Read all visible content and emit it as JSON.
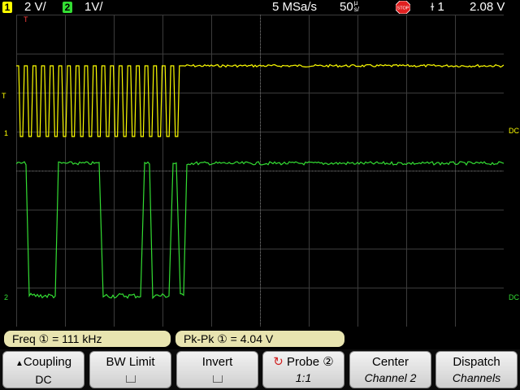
{
  "status": {
    "ch1_num": "1",
    "ch1_scale": "2 V/",
    "ch2_num": "2",
    "ch2_scale": "1V/",
    "sample_rate": "5 MSa/s",
    "timebase": "50",
    "timebase_unit_top": "µ",
    "timebase_unit_bottom": "s/",
    "run_state": "STOP",
    "trigger_source": "1",
    "trigger_level": "2.08  V"
  },
  "markers": {
    "trigger_top": "T",
    "trigger_left": "T",
    "ch1_ground": "1",
    "ch2_ground": "2",
    "dc_right_1": "DC",
    "dc_right_2": "DC"
  },
  "measurements": {
    "freq": "Freq ① = 111 kHz",
    "pkpk": "Pk-Pk ① =  4.04  V"
  },
  "softkeys": {
    "coupling_label": "Coupling",
    "coupling_value": "DC",
    "bw_label": "BW Limit",
    "invert_label": "Invert",
    "probe_label": "Probe ②",
    "probe_value": "1:1",
    "center_label": "Center",
    "center_value": "Channel 2",
    "dispatch_label": "Dispatch",
    "dispatch_value": "Channels"
  },
  "colors": {
    "ch1": "#ffff00",
    "ch2": "#33dd33",
    "grid": "#3c3c3c",
    "grid_center": "#6a6a6a"
  }
}
